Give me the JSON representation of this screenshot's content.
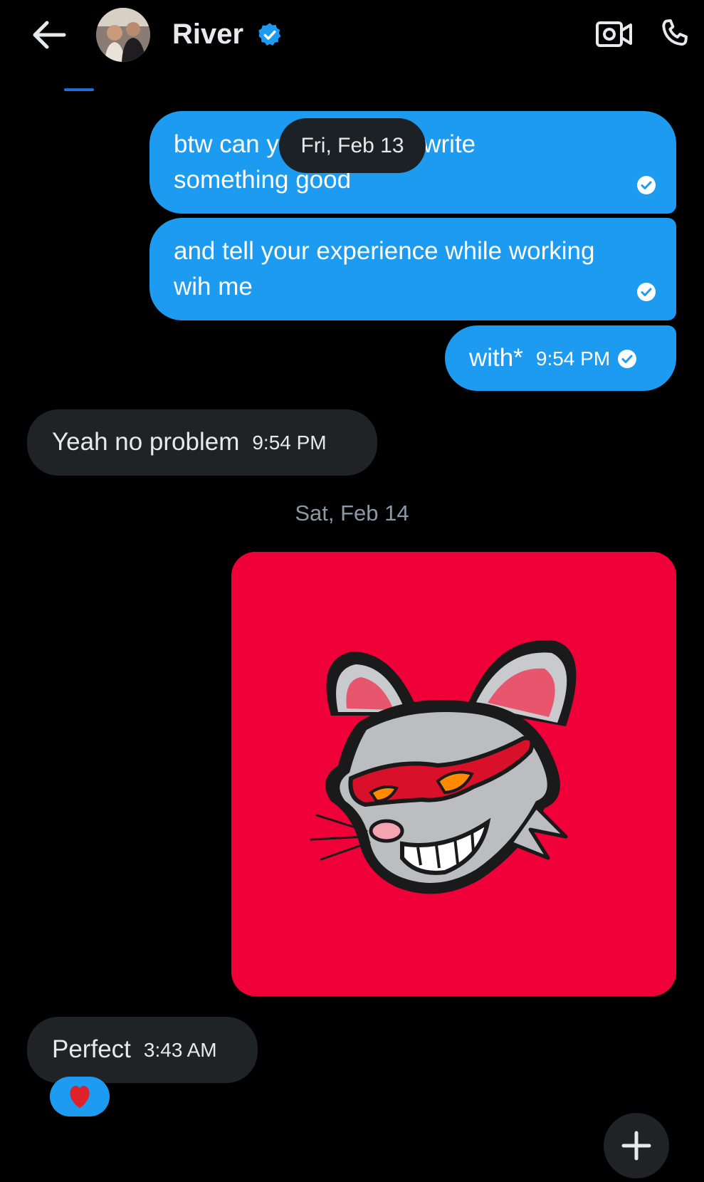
{
  "header": {
    "contact_name": "River",
    "back_icon": "arrow-left-icon",
    "verified_icon": "verified-badge-icon",
    "video_icon": "video-camera-icon",
    "call_icon": "phone-icon"
  },
  "floating_date": "Fri, Feb 13",
  "messages": [
    {
      "direction": "out",
      "text_line1": "btw can y",
      "text_line1_after": "he post and write",
      "text_line2": "something good",
      "status_icon": "read-check-icon"
    },
    {
      "direction": "out",
      "text_line1": "and tell your experience while working",
      "text_line2": "wih me",
      "status_icon": "read-check-icon"
    },
    {
      "direction": "out",
      "text": "with*",
      "time": "9:54 PM",
      "status_icon": "read-check-icon"
    },
    {
      "direction": "in",
      "text": "Yeah no problem",
      "time": "9:54 PM"
    },
    {
      "direction": "out",
      "type": "image",
      "image_subject": "grinning gray rat mascot with red mask on red background"
    },
    {
      "direction": "in",
      "text": "Perfect",
      "time": "3:43 AM",
      "reaction": "❤️"
    }
  ],
  "date_separator": "Sat, Feb 14",
  "colors": {
    "background": "#000000",
    "outgoing_bubble": "#1d9bf0",
    "incoming_bubble": "#1f2326",
    "image_background": "#ef0038"
  },
  "fab_icon": "plus-icon"
}
